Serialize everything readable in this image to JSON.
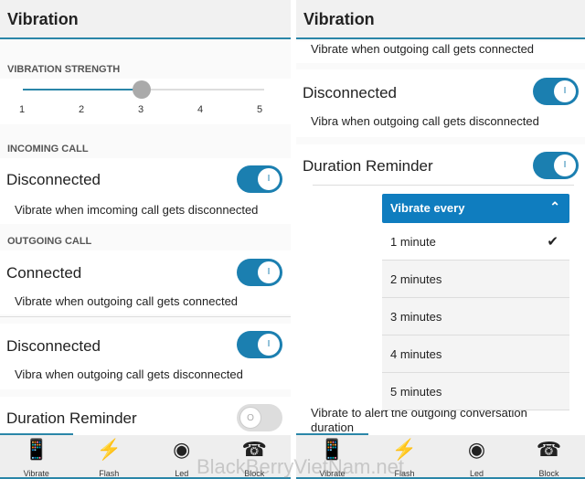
{
  "left": {
    "title": "Vibration",
    "strength": {
      "label": "VIBRATION STRENGTH",
      "ticks": [
        "1",
        "2",
        "3",
        "4",
        "5"
      ],
      "value": 3,
      "min": 1,
      "max": 5
    },
    "incoming_label": "INCOMING CALL",
    "incoming": [
      {
        "title": "Disconnected",
        "desc": "Vibrate when imcoming call gets disconnected",
        "on": true
      }
    ],
    "outgoing_label": "OUTGOING CALL",
    "outgoing": [
      {
        "title": "Connected",
        "desc": "Vibrate when outgoing call gets connected",
        "on": true
      },
      {
        "title": "Disconnected",
        "desc": "Vibra when outgoing call gets disconnected",
        "on": true
      }
    ],
    "duration": {
      "title": "Duration Reminder",
      "on": false
    }
  },
  "right": {
    "title": "Vibration",
    "top_desc": "Vibrate when outgoing call gets connected",
    "disconnected": {
      "title": "Disconnected",
      "desc": "Vibra when outgoing call gets disconnected",
      "on": true
    },
    "duration": {
      "title": "Duration Reminder",
      "on": true,
      "desc": "Vibrate to alert the outgoing conversation duration"
    },
    "dropdown": {
      "label": "Vibrate every",
      "options": [
        "1 minute",
        "2 minutes",
        "3 minutes",
        "4 minutes",
        "5 minutes"
      ],
      "selected": "1 minute"
    }
  },
  "toggle_glyph": "I",
  "toggle_off_glyph": "O",
  "tabs": [
    {
      "label": "Vibrate",
      "icon": "phone-vibrate-icon"
    },
    {
      "label": "Flash",
      "icon": "lightning-icon"
    },
    {
      "label": "Led",
      "icon": "led-icon"
    },
    {
      "label": "Block",
      "icon": "block-call-icon"
    }
  ],
  "watermark": "BlackBerryVietNam.net",
  "colors": {
    "accent": "#1b7fb0",
    "dropdown": "#0f7dbf"
  }
}
